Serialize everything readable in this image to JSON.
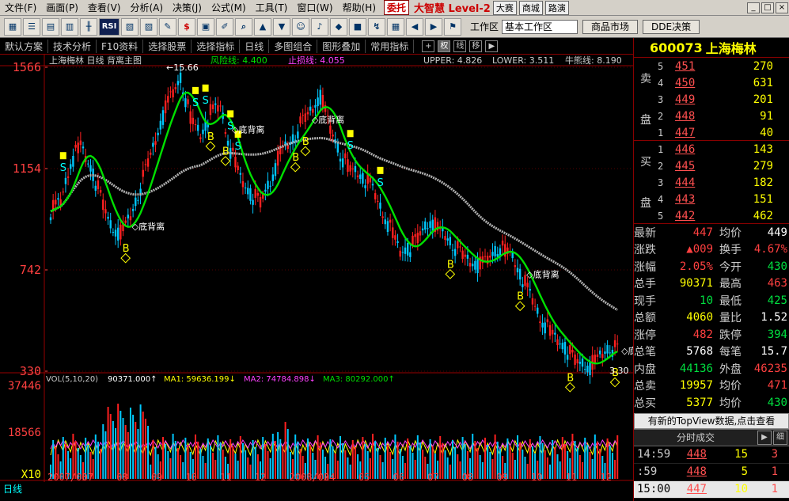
{
  "menu": {
    "items": [
      "文件(F)",
      "画面(P)",
      "查看(V)",
      "分析(A)",
      "决策(J)",
      "公式(M)",
      "工具(T)",
      "窗口(W)",
      "帮助(H)"
    ],
    "entrust": "委托",
    "brand": "大智慧 Level-2",
    "right_buttons": [
      "大赛",
      "商城",
      "路演"
    ]
  },
  "toolbar": {
    "rsi": "RSI",
    "workspace_label": "工作区",
    "workspace_value": "基本工作区",
    "tabs": [
      "商品市场",
      "DDE决策"
    ]
  },
  "strip": {
    "items": [
      "默认方案",
      "技术分析",
      "F10资料",
      "选择股票",
      "选择指标",
      "日线",
      "多图组合",
      "图形叠加",
      "常用指标"
    ],
    "icons": [
      "权",
      "线",
      "移"
    ]
  },
  "chart_header": {
    "title": "上海梅林 日线 背离主图",
    "risk": "风险线: 4.400",
    "stop": "止损线: 4.055",
    "upper": "UPPER: 4.826",
    "lower": "LOWER: 3.511",
    "bull": "牛熊线: 8.190",
    "peak_label": "15.66",
    "low_label": "3.30"
  },
  "colors": {
    "up": "#ff2020",
    "down": "#00c8ff",
    "ma_fast": "#00e000",
    "ma_long": "#b0b0b0",
    "band": "#ffd000"
  },
  "chart_data": {
    "type": "candlestick",
    "yticks": [
      "1566",
      "1154",
      "742",
      "330"
    ],
    "vol_yticks": [
      "37446",
      "18566",
      "X10"
    ],
    "xticks": [
      "2007/05",
      "07",
      "08",
      "09",
      "10",
      "11",
      "12",
      "2008/02",
      "04",
      "05",
      "06",
      "07",
      "08",
      "09",
      "10",
      "11",
      "12"
    ],
    "vol_header": {
      "vol": "VOL(5,10,20)",
      "val": "90371.000↑",
      "ma1": "MA1: 59636.199↓",
      "ma2": "MA2: 74784.898↓",
      "ma3": "MA3: 80292.000↑"
    },
    "close": [
      9.8,
      10.2,
      11.8,
      12.5,
      11.6,
      10.4,
      9.2,
      8.9,
      9.6,
      10.8,
      12.1,
      13.4,
      14.5,
      15.2,
      13.6,
      12.9,
      13.8,
      14.1,
      12.3,
      11.2,
      10.5,
      10.2,
      11.0,
      12.2,
      12.6,
      13.3,
      13.9,
      14.5,
      13.2,
      12.1,
      11.5,
      11.3,
      10.9,
      10.0,
      9.1,
      8.2,
      8.3,
      8.9,
      9.4,
      9.0,
      8.6,
      8.1,
      7.8,
      7.6,
      8.0,
      8.3,
      8.1,
      7.3,
      6.4,
      5.5,
      4.9,
      4.5,
      4.0,
      3.6,
      3.5,
      3.9,
      4.3,
      4.1
    ],
    "divergence_label": "底背离",
    "buy": "B",
    "sell": "S"
  },
  "right_panel": {
    "code": "600073",
    "name": "上海梅林",
    "ask_label": [
      "卖",
      "盘"
    ],
    "bid_label": [
      "买",
      "盘"
    ],
    "asks": [
      {
        "n": "5",
        "p": "451",
        "v": "270"
      },
      {
        "n": "4",
        "p": "450",
        "v": "631"
      },
      {
        "n": "3",
        "p": "449",
        "v": "201"
      },
      {
        "n": "2",
        "p": "448",
        "v": "91"
      },
      {
        "n": "1",
        "p": "447",
        "v": "40"
      }
    ],
    "bids": [
      {
        "n": "1",
        "p": "446",
        "v": "143"
      },
      {
        "n": "2",
        "p": "445",
        "v": "279"
      },
      {
        "n": "3",
        "p": "444",
        "v": "182"
      },
      {
        "n": "4",
        "p": "443",
        "v": "151"
      },
      {
        "n": "5",
        "p": "442",
        "v": "462"
      }
    ],
    "quotes": [
      [
        "最新",
        "447",
        "均价",
        "449"
      ],
      [
        "涨跌",
        "▲009",
        "换手",
        "4.67%"
      ],
      [
        "涨幅",
        "2.05%",
        "今开",
        "430"
      ],
      [
        "总手",
        "90371",
        "最高",
        "463"
      ],
      [
        "现手",
        "10",
        "最低",
        "425"
      ],
      [
        "总额",
        "4060",
        "量比",
        "1.52"
      ],
      [
        "涨停",
        "482",
        "跌停",
        "394"
      ],
      [
        "总笔",
        "5768",
        "每笔",
        "15.7"
      ],
      [
        "内盘",
        "44136",
        "外盘",
        "46235"
      ],
      [
        "总卖",
        "19957",
        "均价",
        "471"
      ],
      [
        "总买",
        "5377",
        "均价",
        "430"
      ]
    ],
    "topview": "有新的TopView数据,点击查看",
    "ticks_title": "分时成交",
    "ticks_side": "细",
    "ticks": [
      {
        "t": "14:59",
        "p": "448",
        "v": "15",
        "c": "3"
      },
      {
        "t": ":59",
        "p": "448",
        "v": "5",
        "c": "1"
      },
      {
        "t": "15:00",
        "p": "447",
        "v": "10",
        "c": "1"
      }
    ]
  },
  "bottom": {
    "tab": "日线"
  }
}
